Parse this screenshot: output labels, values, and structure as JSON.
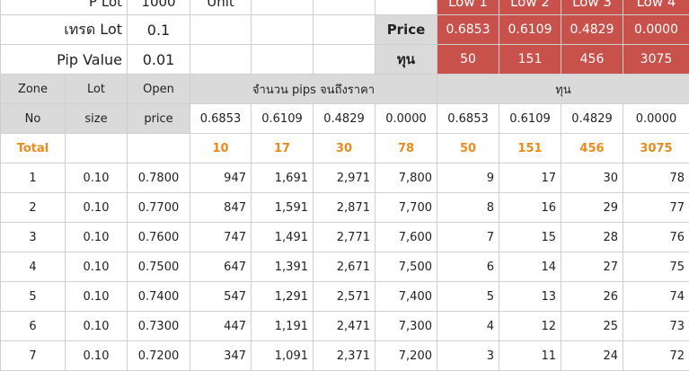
{
  "top": {
    "lot_label": "P Lot",
    "lot_value": "1000",
    "unit_label": "Unit",
    "low_labels": [
      "Low 1",
      "Low 2",
      "Low 3",
      "Low 4"
    ],
    "trade_lot_label": "เทรด Lot",
    "trade_lot_value": "0.1",
    "pip_value_label": "Pip Value",
    "pip_value_value": "0.01",
    "price_label": "Price",
    "capital_label": "ทุน",
    "prices": [
      "0.6853",
      "0.6109",
      "0.4829",
      "0.0000"
    ],
    "capitals": [
      "50",
      "151",
      "456",
      "3075"
    ]
  },
  "colors": {
    "header_gray": "#dadada",
    "price_red": "#c9514b",
    "total_orange": "#ec8a1b"
  },
  "table": {
    "headers_top": {
      "zone": "Zone",
      "lot": "Lot",
      "open": "Open",
      "pips_group": "จำนวน pips จนถึงราคา",
      "capital_group": "ทุน"
    },
    "headers_bottom": {
      "zone": "No",
      "lot": "size",
      "open": "price",
      "pips_prices": [
        "0.6853",
        "0.6109",
        "0.4829",
        "0.0000"
      ],
      "capital_prices": [
        "0.6853",
        "0.6109",
        "0.4829",
        "0.0000"
      ]
    },
    "total": {
      "label": "Total",
      "pips": [
        "10",
        "17",
        "30",
        "78"
      ],
      "capital": [
        "50",
        "151",
        "456",
        "3075"
      ]
    },
    "rows": [
      {
        "no": "1",
        "lot": "0.10",
        "open": "0.7800",
        "pips": [
          "947",
          "1,691",
          "2,971",
          "7,800"
        ],
        "capital": [
          "9",
          "17",
          "30",
          "78"
        ]
      },
      {
        "no": "2",
        "lot": "0.10",
        "open": "0.7700",
        "pips": [
          "847",
          "1,591",
          "2,871",
          "7,700"
        ],
        "capital": [
          "8",
          "16",
          "29",
          "77"
        ]
      },
      {
        "no": "3",
        "lot": "0.10",
        "open": "0.7600",
        "pips": [
          "747",
          "1,491",
          "2,771",
          "7,600"
        ],
        "capital": [
          "7",
          "15",
          "28",
          "76"
        ]
      },
      {
        "no": "4",
        "lot": "0.10",
        "open": "0.7500",
        "pips": [
          "647",
          "1,391",
          "2,671",
          "7,500"
        ],
        "capital": [
          "6",
          "14",
          "27",
          "75"
        ]
      },
      {
        "no": "5",
        "lot": "0.10",
        "open": "0.7400",
        "pips": [
          "547",
          "1,291",
          "2,571",
          "7,400"
        ],
        "capital": [
          "5",
          "13",
          "26",
          "74"
        ]
      },
      {
        "no": "6",
        "lot": "0.10",
        "open": "0.7300",
        "pips": [
          "447",
          "1,191",
          "2,471",
          "7,300"
        ],
        "capital": [
          "4",
          "12",
          "25",
          "73"
        ]
      },
      {
        "no": "7",
        "lot": "0.10",
        "open": "0.7200",
        "pips": [
          "347",
          "1,091",
          "2,371",
          "7,200"
        ],
        "capital": [
          "3",
          "11",
          "24",
          "72"
        ]
      }
    ]
  }
}
